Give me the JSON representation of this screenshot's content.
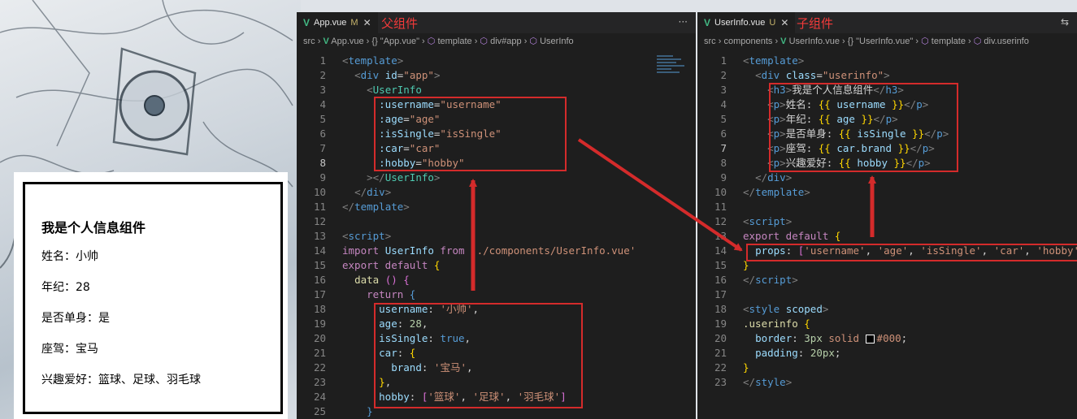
{
  "preview": {
    "heading": "我是个人信息组件",
    "rows": [
      "姓名：小帅",
      "年纪：28",
      "是否单身：是",
      "座驾：宝马",
      "兴趣爱好：篮球、足球、羽毛球"
    ]
  },
  "left_editor": {
    "tab_label": "App.vue",
    "tab_modified": "M",
    "annotation": "父组件",
    "tab_more": "···",
    "breadcrumb": [
      "src",
      "App.vue",
      "{} \"App.vue\"",
      "template",
      "div#app",
      "UserInfo"
    ]
  },
  "right_editor": {
    "tab_label": "UserInfo.vue",
    "tab_modified": "U",
    "annotation": "子组件",
    "breadcrumb": [
      "src",
      "components",
      "UserInfo.vue",
      "{} \"UserInfo.vue\"",
      "template",
      "div.userinfo"
    ]
  },
  "left_code": [
    [
      [
        "t-punc",
        "<"
      ],
      [
        "t-tag",
        "template"
      ],
      [
        "t-punc",
        ">"
      ]
    ],
    [
      [
        "t-text",
        "  "
      ],
      [
        "t-punc",
        "<"
      ],
      [
        "t-tag",
        "div "
      ],
      [
        "t-attr",
        "id"
      ],
      [
        "t-text",
        "="
      ],
      [
        "t-str",
        "\"app\""
      ],
      [
        "t-punc",
        ">"
      ]
    ],
    [
      [
        "t-text",
        "    "
      ],
      [
        "t-punc",
        "<"
      ],
      [
        "t-comp",
        "UserInfo"
      ]
    ],
    [
      [
        "t-text",
        "      "
      ],
      [
        "t-attr",
        ":username"
      ],
      [
        "t-text",
        "="
      ],
      [
        "t-str",
        "\"username\""
      ]
    ],
    [
      [
        "t-text",
        "      "
      ],
      [
        "t-attr",
        ":age"
      ],
      [
        "t-text",
        "="
      ],
      [
        "t-str",
        "\"age\""
      ]
    ],
    [
      [
        "t-text",
        "      "
      ],
      [
        "t-attr",
        ":isSingle"
      ],
      [
        "t-text",
        "="
      ],
      [
        "t-str",
        "\"isSingle\""
      ]
    ],
    [
      [
        "t-text",
        "      "
      ],
      [
        "t-attr",
        ":car"
      ],
      [
        "t-text",
        "="
      ],
      [
        "t-str",
        "\"car\""
      ]
    ],
    [
      [
        "t-text",
        "      "
      ],
      [
        "t-attr",
        ":hobby"
      ],
      [
        "t-text",
        "="
      ],
      [
        "t-str",
        "\"hobby\""
      ]
    ],
    [
      [
        "t-text",
        "    "
      ],
      [
        "t-punc",
        "></"
      ],
      [
        "t-comp",
        "UserInfo"
      ],
      [
        "t-punc",
        ">"
      ]
    ],
    [
      [
        "t-text",
        "  "
      ],
      [
        "t-punc",
        "</"
      ],
      [
        "t-tag",
        "div"
      ],
      [
        "t-punc",
        ">"
      ]
    ],
    [
      [
        "t-punc",
        "</"
      ],
      [
        "t-tag",
        "template"
      ],
      [
        "t-punc",
        ">"
      ]
    ],
    [],
    [
      [
        "t-punc",
        "<"
      ],
      [
        "t-tag",
        "script"
      ],
      [
        "t-punc",
        ">"
      ]
    ],
    [
      [
        "t-kw",
        "import "
      ],
      [
        "t-prop",
        "UserInfo "
      ],
      [
        "t-kw",
        "from "
      ],
      [
        "t-str",
        "'./components/UserInfo.vue'"
      ]
    ],
    [
      [
        "t-kw",
        "export default "
      ],
      [
        "t-brace",
        "{"
      ]
    ],
    [
      [
        "t-text",
        "  "
      ],
      [
        "t-fn",
        "data "
      ],
      [
        "t-pink",
        "() {"
      ]
    ],
    [
      [
        "t-text",
        "    "
      ],
      [
        "t-kw",
        "return "
      ],
      [
        "t-kw2",
        "{"
      ]
    ],
    [
      [
        "t-text",
        "      "
      ],
      [
        "t-prop",
        "username"
      ],
      [
        "t-text",
        ": "
      ],
      [
        "t-str",
        "'小帅'"
      ],
      [
        "t-text",
        ","
      ]
    ],
    [
      [
        "t-text",
        "      "
      ],
      [
        "t-prop",
        "age"
      ],
      [
        "t-text",
        ": "
      ],
      [
        "t-num",
        "28"
      ],
      [
        "t-text",
        ","
      ]
    ],
    [
      [
        "t-text",
        "      "
      ],
      [
        "t-prop",
        "isSingle"
      ],
      [
        "t-text",
        ": "
      ],
      [
        "t-kw2",
        "true"
      ],
      [
        "t-text",
        ","
      ]
    ],
    [
      [
        "t-text",
        "      "
      ],
      [
        "t-prop",
        "car"
      ],
      [
        "t-text",
        ": "
      ],
      [
        "t-brace",
        "{"
      ]
    ],
    [
      [
        "t-text",
        "        "
      ],
      [
        "t-prop",
        "brand"
      ],
      [
        "t-text",
        ": "
      ],
      [
        "t-str",
        "'宝马'"
      ],
      [
        "t-text",
        ","
      ]
    ],
    [
      [
        "t-text",
        "      "
      ],
      [
        "t-brace",
        "}"
      ],
      [
        "t-text",
        ","
      ]
    ],
    [
      [
        "t-text",
        "      "
      ],
      [
        "t-prop",
        "hobby"
      ],
      [
        "t-text",
        ": "
      ],
      [
        "t-pink",
        "["
      ],
      [
        "t-str",
        "'篮球'"
      ],
      [
        "t-text",
        ", "
      ],
      [
        "t-str",
        "'足球'"
      ],
      [
        "t-text",
        ", "
      ],
      [
        "t-str",
        "'羽毛球'"
      ],
      [
        "t-pink",
        "]"
      ]
    ],
    [
      [
        "t-text",
        "    "
      ],
      [
        "t-kw2",
        "}"
      ]
    ]
  ],
  "right_code": [
    [
      [
        "t-punc",
        "<"
      ],
      [
        "t-tag",
        "template"
      ],
      [
        "t-punc",
        ">"
      ]
    ],
    [
      [
        "t-text",
        "  "
      ],
      [
        "t-punc",
        "<"
      ],
      [
        "t-tag",
        "div "
      ],
      [
        "t-attr",
        "class"
      ],
      [
        "t-text",
        "="
      ],
      [
        "t-str",
        "\"userinfo\""
      ],
      [
        "t-punc",
        ">"
      ]
    ],
    [
      [
        "t-text",
        "    "
      ],
      [
        "t-punc",
        "<"
      ],
      [
        "t-tag",
        "h3"
      ],
      [
        "t-punc",
        ">"
      ],
      [
        "t-text",
        "我是个人信息组件"
      ],
      [
        "t-punc",
        "</"
      ],
      [
        "t-tag",
        "h3"
      ],
      [
        "t-punc",
        ">"
      ]
    ],
    [
      [
        "t-text",
        "    "
      ],
      [
        "t-punc",
        "<"
      ],
      [
        "t-tag",
        "p"
      ],
      [
        "t-punc",
        ">"
      ],
      [
        "t-text",
        "姓名: "
      ],
      [
        "t-brace",
        "{{ "
      ],
      [
        "t-prop",
        "username"
      ],
      [
        "t-brace",
        " }}"
      ],
      [
        "t-punc",
        "</"
      ],
      [
        "t-tag",
        "p"
      ],
      [
        "t-punc",
        ">"
      ]
    ],
    [
      [
        "t-text",
        "    "
      ],
      [
        "t-punc",
        "<"
      ],
      [
        "t-tag",
        "p"
      ],
      [
        "t-punc",
        ">"
      ],
      [
        "t-text",
        "年纪: "
      ],
      [
        "t-brace",
        "{{ "
      ],
      [
        "t-prop",
        "age"
      ],
      [
        "t-brace",
        " }}"
      ],
      [
        "t-punc",
        "</"
      ],
      [
        "t-tag",
        "p"
      ],
      [
        "t-punc",
        ">"
      ]
    ],
    [
      [
        "t-text",
        "    "
      ],
      [
        "t-punc",
        "<"
      ],
      [
        "t-tag",
        "p"
      ],
      [
        "t-punc",
        ">"
      ],
      [
        "t-text",
        "是否单身: "
      ],
      [
        "t-brace",
        "{{ "
      ],
      [
        "t-prop",
        "isSingle"
      ],
      [
        "t-brace",
        " }}"
      ],
      [
        "t-punc",
        "</"
      ],
      [
        "t-tag",
        "p"
      ],
      [
        "t-punc",
        ">"
      ]
    ],
    [
      [
        "t-text",
        "    "
      ],
      [
        "t-punc",
        "<"
      ],
      [
        "t-tag",
        "p"
      ],
      [
        "t-punc",
        ">"
      ],
      [
        "t-text",
        "座驾: "
      ],
      [
        "t-brace",
        "{{ "
      ],
      [
        "t-prop",
        "car.brand"
      ],
      [
        "t-brace",
        " }}"
      ],
      [
        "t-punc",
        "</"
      ],
      [
        "t-tag",
        "p"
      ],
      [
        "t-punc",
        ">"
      ]
    ],
    [
      [
        "t-text",
        "    "
      ],
      [
        "t-punc",
        "<"
      ],
      [
        "t-tag",
        "p"
      ],
      [
        "t-punc",
        ">"
      ],
      [
        "t-text",
        "兴趣爱好: "
      ],
      [
        "t-brace",
        "{{ "
      ],
      [
        "t-prop",
        "hobby"
      ],
      [
        "t-brace",
        " }}"
      ],
      [
        "t-punc",
        "</"
      ],
      [
        "t-tag",
        "p"
      ],
      [
        "t-punc",
        ">"
      ]
    ],
    [
      [
        "t-text",
        "  "
      ],
      [
        "t-punc",
        "</"
      ],
      [
        "t-tag",
        "div"
      ],
      [
        "t-punc",
        ">"
      ]
    ],
    [
      [
        "t-punc",
        "</"
      ],
      [
        "t-tag",
        "template"
      ],
      [
        "t-punc",
        ">"
      ]
    ],
    [],
    [
      [
        "t-punc",
        "<"
      ],
      [
        "t-tag",
        "script"
      ],
      [
        "t-punc",
        ">"
      ]
    ],
    [
      [
        "t-kw",
        "export default "
      ],
      [
        "t-brace",
        "{"
      ]
    ],
    [
      [
        "t-text",
        "  "
      ],
      [
        "t-prop",
        "props"
      ],
      [
        "t-text",
        ": "
      ],
      [
        "t-pink",
        "["
      ],
      [
        "t-str",
        "'username'"
      ],
      [
        "t-text",
        ", "
      ],
      [
        "t-str",
        "'age'"
      ],
      [
        "t-text",
        ", "
      ],
      [
        "t-str",
        "'isSingle'"
      ],
      [
        "t-text",
        ", "
      ],
      [
        "t-str",
        "'car'"
      ],
      [
        "t-text",
        ", "
      ],
      [
        "t-str",
        "'hobby'"
      ],
      [
        "t-pink",
        "]"
      ]
    ],
    [
      [
        "t-brace",
        "}"
      ]
    ],
    [
      [
        "t-punc",
        "</"
      ],
      [
        "t-tag",
        "script"
      ],
      [
        "t-punc",
        ">"
      ]
    ],
    [],
    [
      [
        "t-punc",
        "<"
      ],
      [
        "t-tag",
        "style "
      ],
      [
        "t-attr",
        "scoped"
      ],
      [
        "t-punc",
        ">"
      ]
    ],
    [
      [
        "t-fn",
        ".userinfo "
      ],
      [
        "t-brace",
        "{"
      ]
    ],
    [
      [
        "t-text",
        "  "
      ],
      [
        "t-prop",
        "border"
      ],
      [
        "t-text",
        ": "
      ],
      [
        "t-num",
        "3px "
      ],
      [
        "t-str",
        "solid "
      ],
      [
        "t-box",
        ""
      ],
      [
        "t-str",
        "#000"
      ],
      [
        "t-text",
        ";"
      ]
    ],
    [
      [
        "t-text",
        "  "
      ],
      [
        "t-prop",
        "padding"
      ],
      [
        "t-text",
        ": "
      ],
      [
        "t-num",
        "20px"
      ],
      [
        "t-text",
        ";"
      ]
    ],
    [
      [
        "t-brace",
        "}"
      ]
    ],
    [
      [
        "t-punc",
        "</"
      ],
      [
        "t-tag",
        "style"
      ],
      [
        "t-punc",
        ">"
      ]
    ]
  ],
  "left_current_line": 8,
  "right_current_line": 7
}
